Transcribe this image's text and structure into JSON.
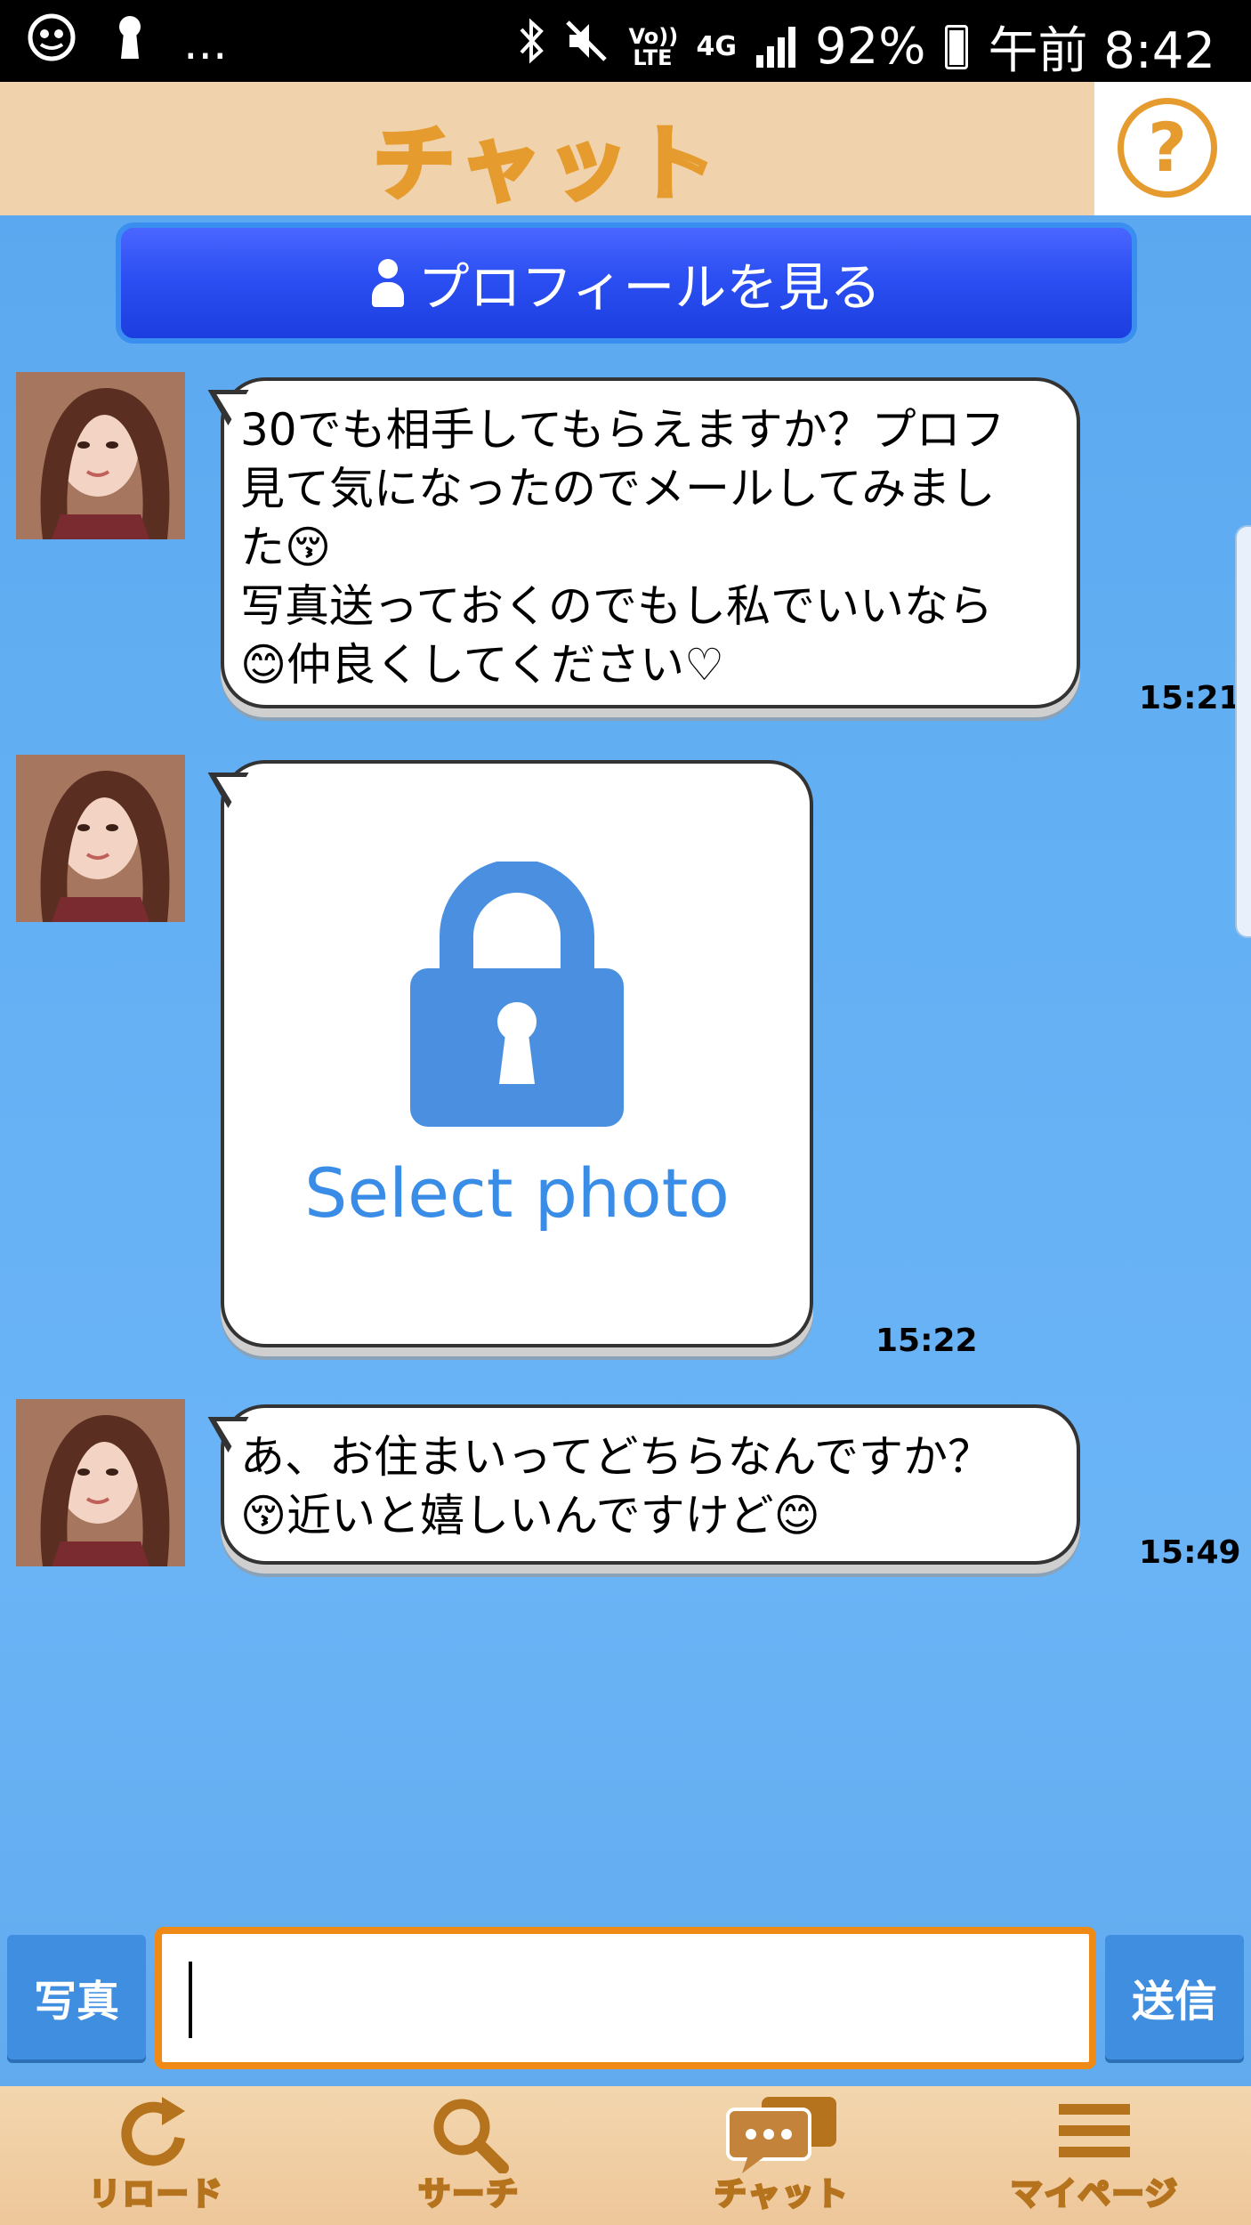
{
  "status_bar": {
    "network_label": "Vo)) LTE",
    "network_type": "4G",
    "battery": "92%",
    "time": "午前 8:42",
    "overflow": "..."
  },
  "header": {
    "title": "チャット",
    "help_label": "?"
  },
  "profile_button": {
    "label": "プロフィールを見る"
  },
  "messages": [
    {
      "text": "30でも相手してもらえますか？プロフ\n見て気になったのでメールしてみまし\nた😚\n写真送っておくのでもし私でいいなら\n😊仲良くしてください♡",
      "time": "15:21"
    },
    {
      "type": "photo",
      "photo_label": "Select photo",
      "time": "15:22"
    },
    {
      "text": "あ、お住まいってどちらなんですか？\n😚近いと嬉しいんですけど😊",
      "time": "15:49"
    }
  ],
  "composer": {
    "photo_label": "写真",
    "send_label": "送信",
    "input_value": ""
  },
  "bottom_nav": [
    {
      "label": "リロード",
      "icon": "reload-icon"
    },
    {
      "label": "サーチ",
      "icon": "search-icon"
    },
    {
      "label": "チャット",
      "icon": "chat-icon"
    },
    {
      "label": "マイページ",
      "icon": "menu-icon"
    }
  ],
  "colors": {
    "accent_orange": "#e59b2e",
    "header_bg": "#f0d3ac",
    "chat_bg": "#64b0f4",
    "profile_button": "#2b4ff2"
  }
}
